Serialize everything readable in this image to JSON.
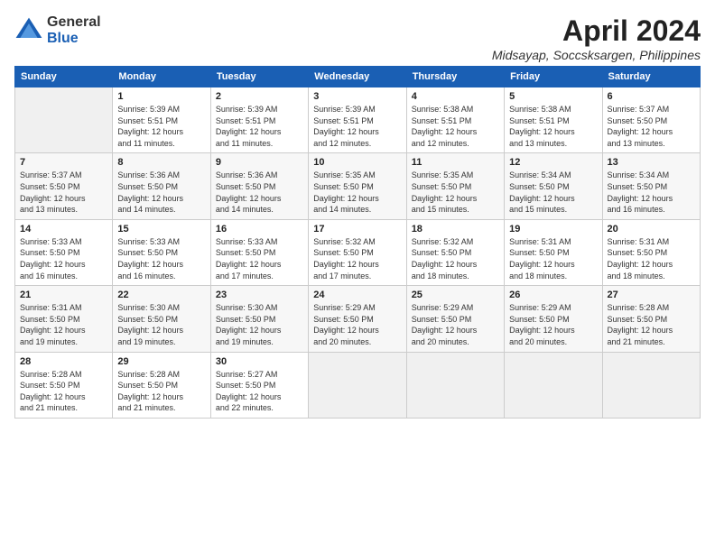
{
  "header": {
    "logo_general": "General",
    "logo_blue": "Blue",
    "month_title": "April 2024",
    "location": "Midsayap, Soccsksargen, Philippines"
  },
  "days_of_week": [
    "Sunday",
    "Monday",
    "Tuesday",
    "Wednesday",
    "Thursday",
    "Friday",
    "Saturday"
  ],
  "weeks": [
    [
      {
        "day": "",
        "info": ""
      },
      {
        "day": "1",
        "info": "Sunrise: 5:39 AM\nSunset: 5:51 PM\nDaylight: 12 hours\nand 11 minutes."
      },
      {
        "day": "2",
        "info": "Sunrise: 5:39 AM\nSunset: 5:51 PM\nDaylight: 12 hours\nand 11 minutes."
      },
      {
        "day": "3",
        "info": "Sunrise: 5:39 AM\nSunset: 5:51 PM\nDaylight: 12 hours\nand 12 minutes."
      },
      {
        "day": "4",
        "info": "Sunrise: 5:38 AM\nSunset: 5:51 PM\nDaylight: 12 hours\nand 12 minutes."
      },
      {
        "day": "5",
        "info": "Sunrise: 5:38 AM\nSunset: 5:51 PM\nDaylight: 12 hours\nand 13 minutes."
      },
      {
        "day": "6",
        "info": "Sunrise: 5:37 AM\nSunset: 5:50 PM\nDaylight: 12 hours\nand 13 minutes."
      }
    ],
    [
      {
        "day": "7",
        "info": "Sunrise: 5:37 AM\nSunset: 5:50 PM\nDaylight: 12 hours\nand 13 minutes."
      },
      {
        "day": "8",
        "info": "Sunrise: 5:36 AM\nSunset: 5:50 PM\nDaylight: 12 hours\nand 14 minutes."
      },
      {
        "day": "9",
        "info": "Sunrise: 5:36 AM\nSunset: 5:50 PM\nDaylight: 12 hours\nand 14 minutes."
      },
      {
        "day": "10",
        "info": "Sunrise: 5:35 AM\nSunset: 5:50 PM\nDaylight: 12 hours\nand 14 minutes."
      },
      {
        "day": "11",
        "info": "Sunrise: 5:35 AM\nSunset: 5:50 PM\nDaylight: 12 hours\nand 15 minutes."
      },
      {
        "day": "12",
        "info": "Sunrise: 5:34 AM\nSunset: 5:50 PM\nDaylight: 12 hours\nand 15 minutes."
      },
      {
        "day": "13",
        "info": "Sunrise: 5:34 AM\nSunset: 5:50 PM\nDaylight: 12 hours\nand 16 minutes."
      }
    ],
    [
      {
        "day": "14",
        "info": "Sunrise: 5:33 AM\nSunset: 5:50 PM\nDaylight: 12 hours\nand 16 minutes."
      },
      {
        "day": "15",
        "info": "Sunrise: 5:33 AM\nSunset: 5:50 PM\nDaylight: 12 hours\nand 16 minutes."
      },
      {
        "day": "16",
        "info": "Sunrise: 5:33 AM\nSunset: 5:50 PM\nDaylight: 12 hours\nand 17 minutes."
      },
      {
        "day": "17",
        "info": "Sunrise: 5:32 AM\nSunset: 5:50 PM\nDaylight: 12 hours\nand 17 minutes."
      },
      {
        "day": "18",
        "info": "Sunrise: 5:32 AM\nSunset: 5:50 PM\nDaylight: 12 hours\nand 18 minutes."
      },
      {
        "day": "19",
        "info": "Sunrise: 5:31 AM\nSunset: 5:50 PM\nDaylight: 12 hours\nand 18 minutes."
      },
      {
        "day": "20",
        "info": "Sunrise: 5:31 AM\nSunset: 5:50 PM\nDaylight: 12 hours\nand 18 minutes."
      }
    ],
    [
      {
        "day": "21",
        "info": "Sunrise: 5:31 AM\nSunset: 5:50 PM\nDaylight: 12 hours\nand 19 minutes."
      },
      {
        "day": "22",
        "info": "Sunrise: 5:30 AM\nSunset: 5:50 PM\nDaylight: 12 hours\nand 19 minutes."
      },
      {
        "day": "23",
        "info": "Sunrise: 5:30 AM\nSunset: 5:50 PM\nDaylight: 12 hours\nand 19 minutes."
      },
      {
        "day": "24",
        "info": "Sunrise: 5:29 AM\nSunset: 5:50 PM\nDaylight: 12 hours\nand 20 minutes."
      },
      {
        "day": "25",
        "info": "Sunrise: 5:29 AM\nSunset: 5:50 PM\nDaylight: 12 hours\nand 20 minutes."
      },
      {
        "day": "26",
        "info": "Sunrise: 5:29 AM\nSunset: 5:50 PM\nDaylight: 12 hours\nand 20 minutes."
      },
      {
        "day": "27",
        "info": "Sunrise: 5:28 AM\nSunset: 5:50 PM\nDaylight: 12 hours\nand 21 minutes."
      }
    ],
    [
      {
        "day": "28",
        "info": "Sunrise: 5:28 AM\nSunset: 5:50 PM\nDaylight: 12 hours\nand 21 minutes."
      },
      {
        "day": "29",
        "info": "Sunrise: 5:28 AM\nSunset: 5:50 PM\nDaylight: 12 hours\nand 21 minutes."
      },
      {
        "day": "30",
        "info": "Sunrise: 5:27 AM\nSunset: 5:50 PM\nDaylight: 12 hours\nand 22 minutes."
      },
      {
        "day": "",
        "info": ""
      },
      {
        "day": "",
        "info": ""
      },
      {
        "day": "",
        "info": ""
      },
      {
        "day": "",
        "info": ""
      }
    ]
  ]
}
